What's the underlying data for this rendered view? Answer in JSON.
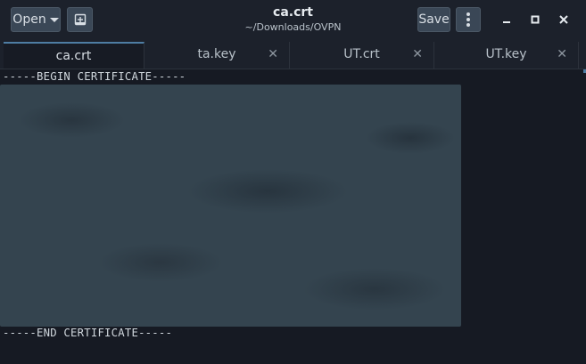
{
  "header": {
    "open_label": "Open",
    "save_label": "Save",
    "title": "ca.crt",
    "subtitle": "~/Downloads/OVPN"
  },
  "tabs": [
    {
      "label": "ca.crt",
      "close": "✕"
    },
    {
      "label": "ta.key",
      "close": "✕"
    },
    {
      "label": "UT.crt",
      "close": "✕"
    },
    {
      "label": "UT.key",
      "close": "✕"
    }
  ],
  "editor": {
    "begin_line": "-----BEGIN CERTIFICATE-----",
    "end_line": "-----END CERTIFICATE-----"
  },
  "icons": {
    "open_menu": "chevron-down-icon",
    "new_document": "new-document-icon",
    "app_menu": "vertical-dots-icon",
    "minimize": "minimize-icon",
    "maximize": "maximize-icon",
    "close": "close-icon"
  },
  "colors": {
    "accent": "#4e7da3",
    "background": "#161a23",
    "button": "#3a4756"
  }
}
